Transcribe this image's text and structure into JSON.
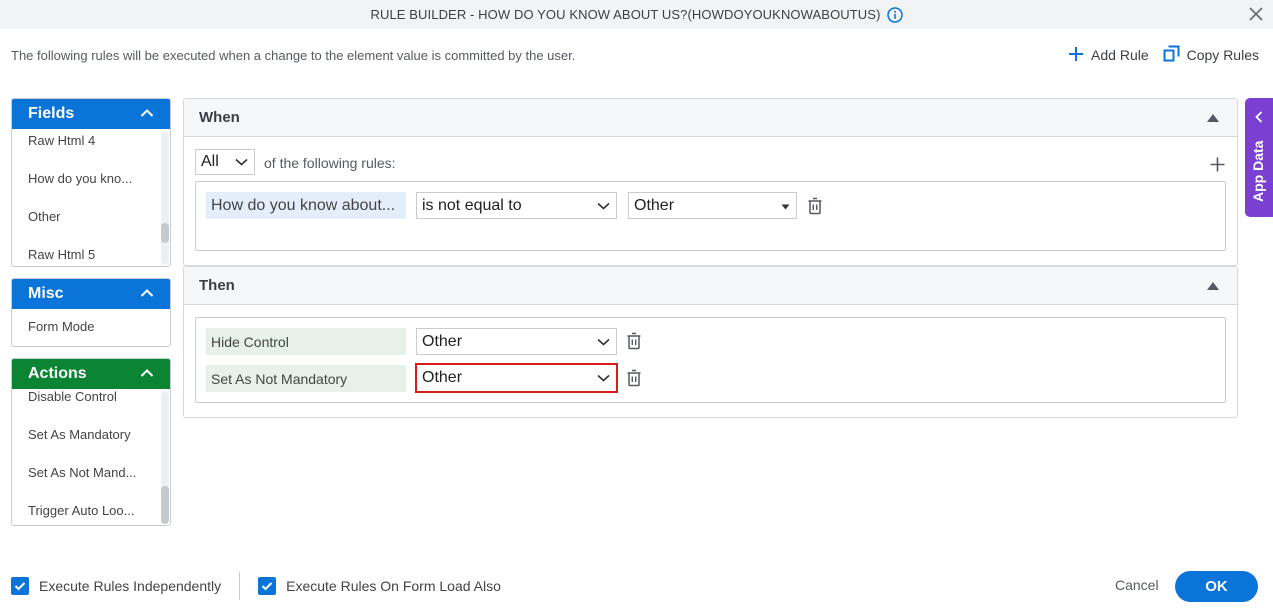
{
  "dialog": {
    "title": "RULE BUILDER - HOW DO YOU KNOW ABOUT US?(HOWDOYOUKNOWABOUTUS)",
    "description": "The following rules will be executed when a change to the element value is committed by the user."
  },
  "toolbar": {
    "add_rule": "Add Rule",
    "copy_rules": "Copy Rules"
  },
  "sidebar": {
    "fields": {
      "title": "Fields",
      "items": [
        "Raw Html 4",
        "How do you kno...",
        "Other",
        "Raw Html 5"
      ]
    },
    "misc": {
      "title": "Misc",
      "items": [
        "Form Mode"
      ]
    },
    "actions": {
      "title": "Actions",
      "items": [
        "Disable Control",
        "Set As Mandatory",
        "Set As Not Mand...",
        "Trigger Auto Loo..."
      ]
    }
  },
  "when": {
    "title": "When",
    "match_mode": "All",
    "match_suffix": "of the following rules:",
    "condition": {
      "field": "How do you know about...",
      "operator": "is not equal to",
      "value": "Other"
    }
  },
  "then": {
    "title": "Then",
    "actions": [
      {
        "action": "Hide Control",
        "target": "Other"
      },
      {
        "action": "Set As Not Mandatory",
        "target": "Other"
      }
    ]
  },
  "app_data": {
    "label": "App Data"
  },
  "footer": {
    "execute_independently": "Execute Rules Independently",
    "execute_on_load": "Execute Rules On Form Load Also",
    "cancel": "Cancel",
    "ok": "OK"
  },
  "colors": {
    "primary": "#0a74d9",
    "actions_header": "#0b8433",
    "app_data": "#7b3fd1",
    "error_border": "#d81b1b"
  }
}
